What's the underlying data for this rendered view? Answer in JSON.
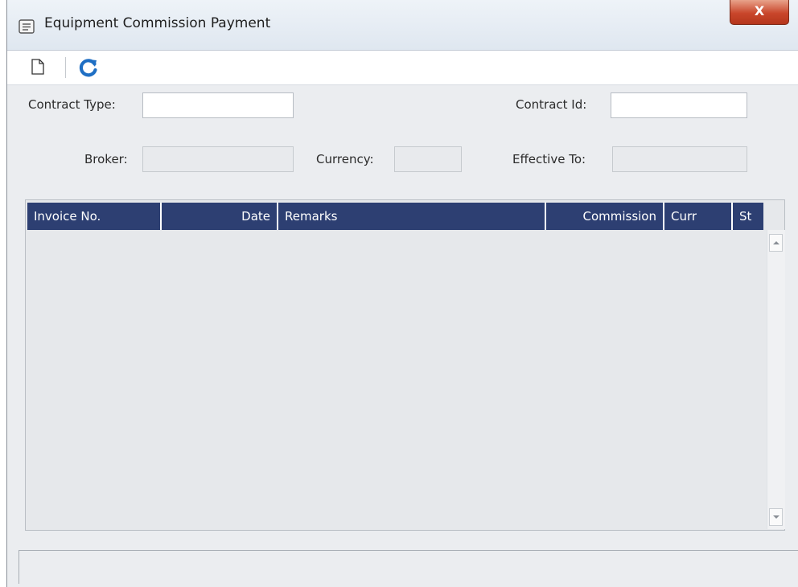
{
  "window": {
    "title": "Equipment Commission Payment",
    "close_label": "X",
    "title_icon": "form-icon"
  },
  "toolbar": {
    "new_icon": "new-document-icon",
    "refresh_icon": "refresh-icon"
  },
  "form": {
    "contract_type_label": "Contract Type:",
    "contract_type_value": "",
    "contract_id_label": "Contract Id:",
    "contract_id_value": "",
    "broker_label": "Broker:",
    "broker_value": "",
    "currency_label": "Currency:",
    "currency_value": "",
    "effective_to_label": "Effective To:",
    "effective_to_value": ""
  },
  "grid": {
    "columns": [
      {
        "label": "Invoice No.",
        "align": "left"
      },
      {
        "label": "Date",
        "align": "right"
      },
      {
        "label": "Remarks",
        "align": "left"
      },
      {
        "label": "Commission",
        "align": "right"
      },
      {
        "label": "Curr",
        "align": "left"
      },
      {
        "label": "St",
        "align": "left"
      }
    ],
    "rows": []
  },
  "colors": {
    "grid_header": "#2d3f72",
    "refresh_icon": "#1f6fc4",
    "close_button": "#c9462b"
  }
}
